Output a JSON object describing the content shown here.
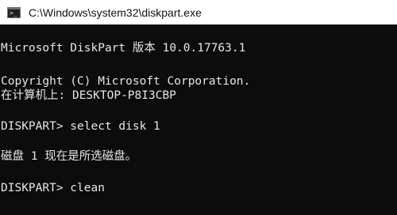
{
  "window": {
    "title": "C:\\Windows\\system32\\diskpart.exe"
  },
  "console": {
    "lines": [
      "Microsoft DiskPart 版本 10.0.17763.1",
      "Copyright (C) Microsoft Corporation.",
      "在计算机上: DESKTOP-P8I3CBP",
      "DISKPART> select disk 1",
      "磁盘 1 现在是所选磁盘。",
      "DISKPART> clean"
    ]
  },
  "colors": {
    "background": "#0c0c0c",
    "text": "#e6e6e6",
    "titlebar": "#ffffff"
  }
}
